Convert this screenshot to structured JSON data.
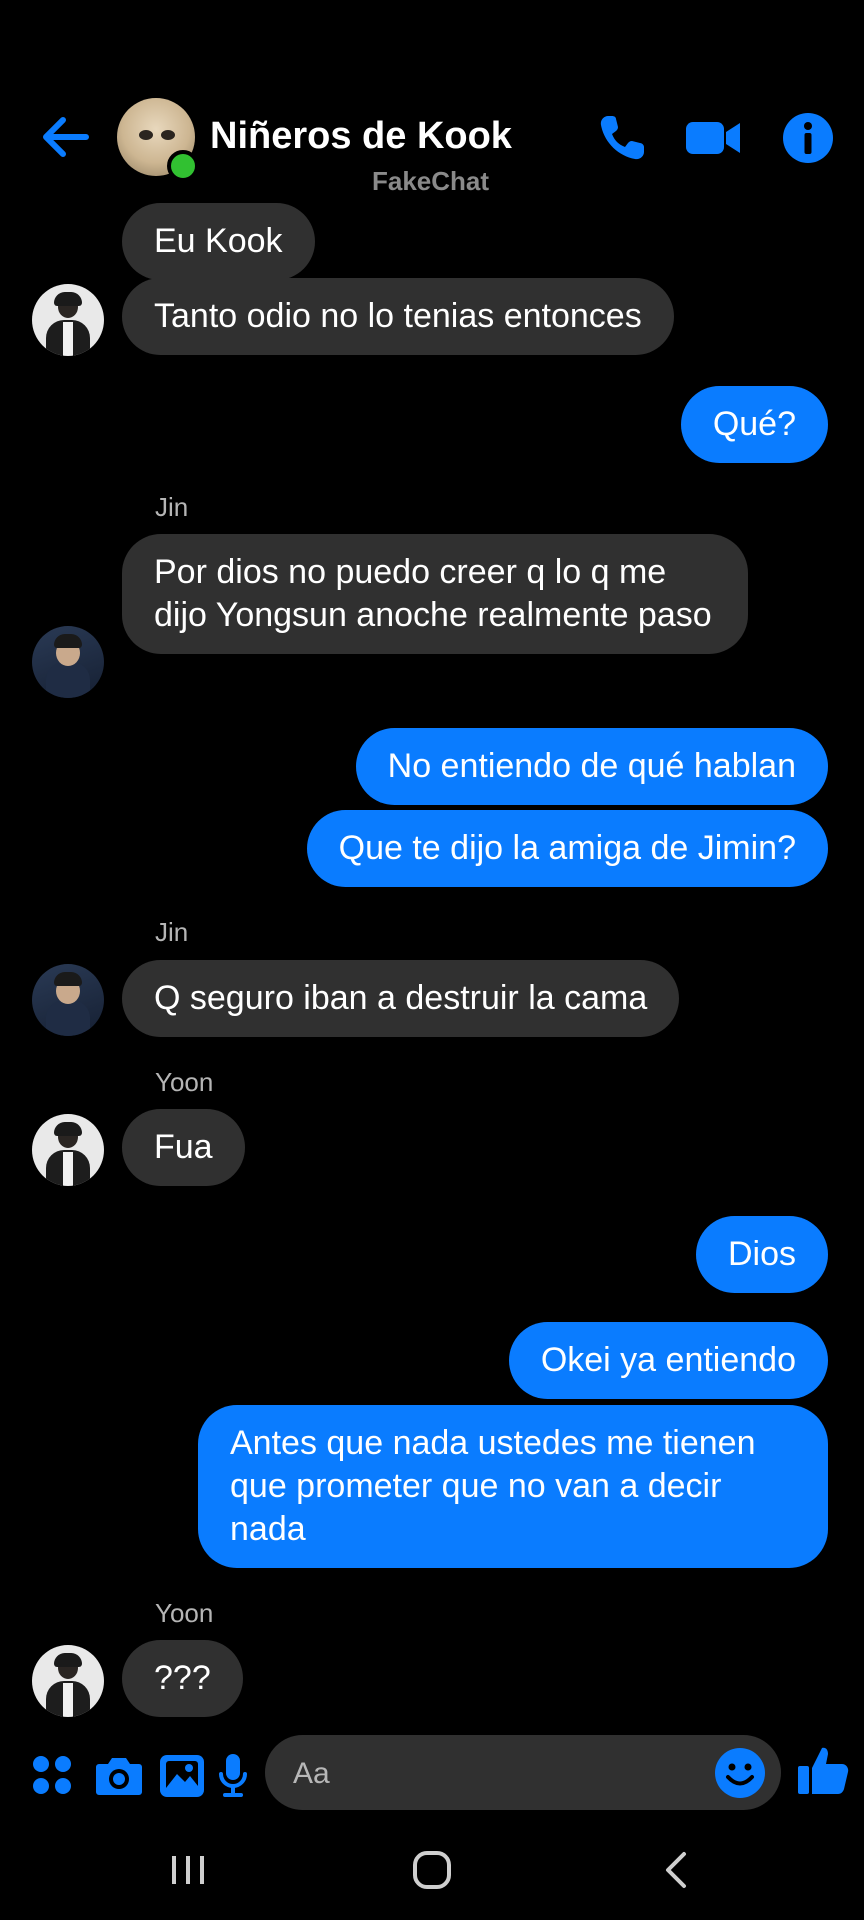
{
  "header": {
    "title": "Niñeros de Kook",
    "watermark": "FakeChat",
    "accent_color": "#0a7cff",
    "online_color": "#31c131",
    "icons": [
      "back-arrow-icon",
      "phone-icon",
      "video-camera-icon",
      "info-icon"
    ]
  },
  "messages": [
    {
      "direction": "in",
      "text": "Eu Kook"
    },
    {
      "direction": "in",
      "text": "Tanto odio no lo tenias entonces"
    },
    {
      "direction": "out",
      "text": "Qué?"
    },
    {
      "direction": "in",
      "sender": "Jin",
      "text": "Por dios no puedo creer q lo q me dijo Yongsun anoche realmente paso"
    },
    {
      "direction": "out",
      "text": "No entiendo de qué hablan"
    },
    {
      "direction": "out",
      "text": "Que te dijo la amiga de Jimin?"
    },
    {
      "direction": "in",
      "sender": "Jin",
      "text": "Q seguro iban a destruir la cama"
    },
    {
      "direction": "in",
      "sender": "Yoon",
      "text": "Fua"
    },
    {
      "direction": "out",
      "text": "Dios"
    },
    {
      "direction": "out",
      "text": "Okei ya entiendo"
    },
    {
      "direction": "out",
      "text": "Antes que nada ustedes me tienen que prometer que no van a decir nada"
    },
    {
      "direction": "in",
      "sender": "Yoon",
      "text": "???"
    }
  ],
  "composer": {
    "placeholder": "Aa",
    "icons": [
      "apps-icon",
      "camera-icon",
      "gallery-icon",
      "microphone-icon",
      "emoji-icon",
      "thumbs-up-icon"
    ]
  },
  "nav_bar": {
    "icons": [
      "recents-icon",
      "home-icon",
      "back-icon"
    ]
  },
  "colors": {
    "background": "#000000",
    "incoming_bubble": "#303030",
    "outgoing_bubble": "#0a7cff"
  }
}
